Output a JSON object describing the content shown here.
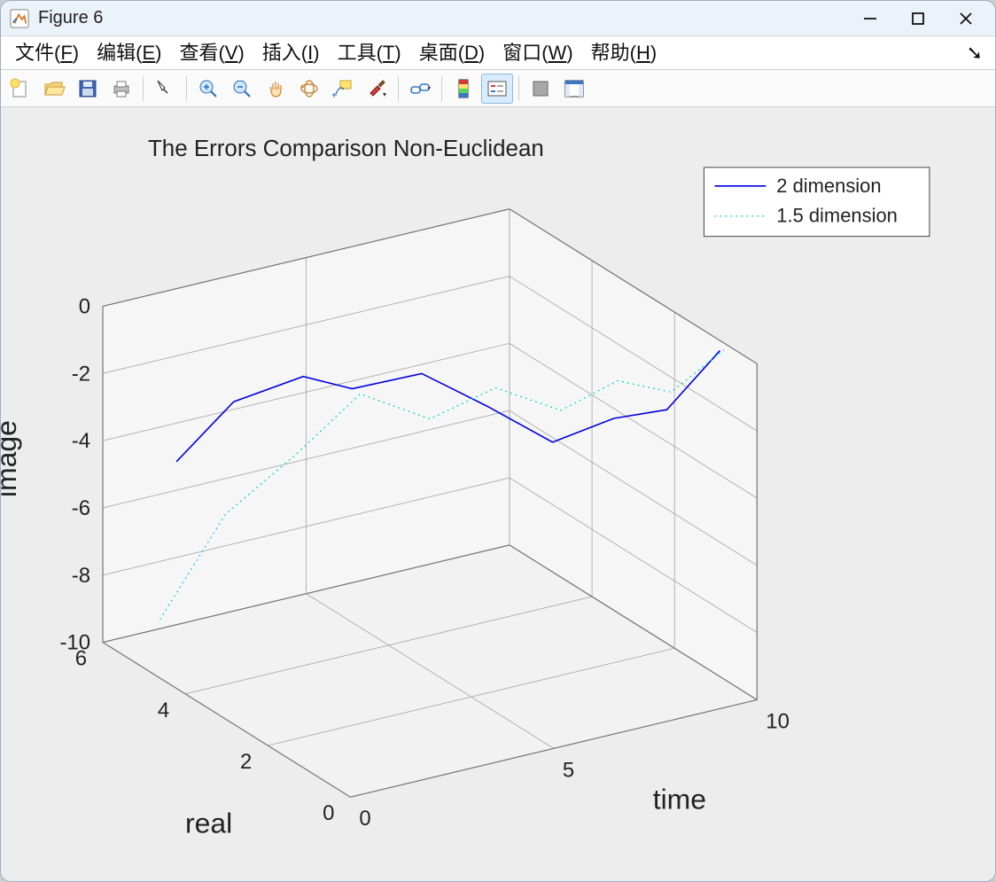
{
  "window": {
    "title": "Figure 6"
  },
  "menu": {
    "file": {
      "label": "文件(",
      "hotkey": "F",
      "tail": ")"
    },
    "edit": {
      "label": "编辑(",
      "hotkey": "E",
      "tail": ")"
    },
    "view": {
      "label": "查看(",
      "hotkey": "V",
      "tail": ")"
    },
    "insert": {
      "label": "插入(",
      "hotkey": "I",
      "tail": ")"
    },
    "tools": {
      "label": "工具(",
      "hotkey": "T",
      "tail": ")"
    },
    "desktop": {
      "label": "桌面(",
      "hotkey": "D",
      "tail": ")"
    },
    "window_menu": {
      "label": "窗口(",
      "hotkey": "W",
      "tail": ")"
    },
    "help": {
      "label": "帮助(",
      "hotkey": "H",
      "tail": ")"
    }
  },
  "toolbar": {
    "icons": [
      "new-figure",
      "open",
      "save",
      "print",
      "edit-plot",
      "zoom-in",
      "zoom-out",
      "pan",
      "rotate-3d",
      "data-cursor",
      "brush",
      "link-data",
      "colorbar",
      "legend",
      "hide-toolbar",
      "dock"
    ]
  },
  "chart_data": {
    "type": "line",
    "projection": "3d",
    "title": "The Errors Comparison Non-Euclidean",
    "xlabel": "time",
    "ylabel": "real",
    "zlabel": "image",
    "xlim": [
      0,
      10
    ],
    "ylim": [
      0,
      6
    ],
    "zlim": [
      -10,
      0
    ],
    "xticks": [
      0,
      5,
      10
    ],
    "yticks": [
      0,
      2,
      4,
      6
    ],
    "zticks": [
      -10,
      -8,
      -6,
      -4,
      -2,
      0
    ],
    "legend": {
      "entries": [
        "2 dimension",
        "1.5 dimension"
      ],
      "position": "upper-right"
    },
    "series": [
      {
        "name": "2 dimension",
        "style": "solid",
        "color": "#0000e0",
        "t": [
          1,
          2,
          3,
          4,
          5,
          6,
          7,
          8,
          9,
          10
        ],
        "real": [
          5.2,
          4.8,
          4.1,
          3.9,
          3.2,
          2.6,
          2.0,
          1.5,
          1.2,
          0.9
        ],
        "image": [
          -4.3,
          -2.5,
          -1.5,
          -2.0,
          -1.3,
          -2.1,
          -3.0,
          -2.2,
          -2.0,
          -0.3
        ]
      },
      {
        "name": "1.5 dimension",
        "style": "dotted",
        "color": "#00cfd6",
        "t": [
          1,
          2,
          3,
          4,
          5,
          6,
          7,
          8,
          9,
          10
        ],
        "real": [
          5.6,
          5.0,
          4.3,
          3.7,
          3.0,
          2.4,
          1.8,
          1.4,
          1.1,
          0.8
        ],
        "image": [
          -9.3,
          -6.0,
          -4.0,
          -2.0,
          -2.5,
          -1.4,
          -1.9,
          -1.0,
          -1.4,
          -0.2
        ]
      }
    ]
  }
}
